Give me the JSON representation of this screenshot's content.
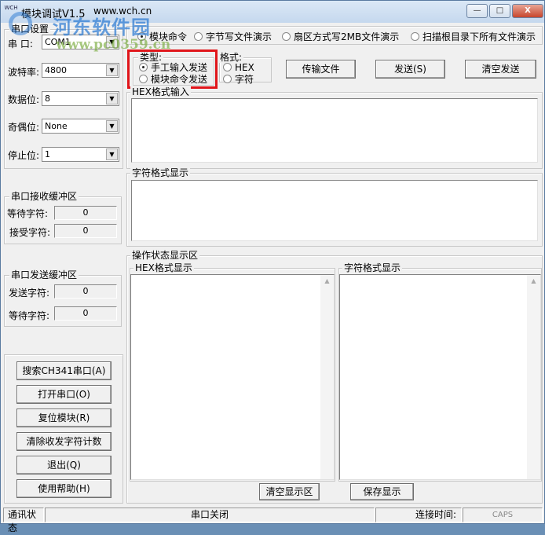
{
  "window": {
    "title": "模块调试V1.5",
    "url": "www.wch.cn",
    "min": "—",
    "max": "□",
    "close": "X",
    "icon_text": "WCH"
  },
  "watermark": {
    "site": "河东软件园",
    "url": "www.pc0359.cn"
  },
  "serial": {
    "group": "串口设置",
    "port_label": "串 口:",
    "port": "COM1",
    "baud_label": "波特率:",
    "baud": "4800",
    "data_label": "数据位:",
    "data": "8",
    "parity_label": "奇偶位:",
    "parity": "None",
    "stop_label": "停止位:",
    "stop": "1"
  },
  "modes": [
    {
      "label": "模块命令",
      "checked": true
    },
    {
      "label": "字节写文件演示",
      "checked": false
    },
    {
      "label": "扇区方式写2MB文件演示",
      "checked": false
    },
    {
      "label": "扫描根目录下所有文件演示",
      "checked": false
    }
  ],
  "type": {
    "group": "类型:",
    "options": [
      {
        "label": "手工输入发送",
        "checked": true
      },
      {
        "label": "模块命令发送",
        "checked": false
      }
    ]
  },
  "format": {
    "group": "格式:",
    "options": [
      {
        "label": "HEX",
        "checked": false
      },
      {
        "label": "字符",
        "checked": false
      }
    ]
  },
  "buttons": {
    "transfer": "传输文件",
    "send": "发送(S)",
    "clear_send": "清空发送",
    "clear_display": "清空显示区",
    "save_display": "保存显示"
  },
  "hex_input": {
    "group": "HEX格式输入",
    "value": ""
  },
  "char_display": {
    "group": "字符格式显示",
    "value": ""
  },
  "rx_buffer": {
    "group": "串口接收缓冲区",
    "wait_label": "等待字符:",
    "wait": "0",
    "recv_label": "接受字符:",
    "recv": "0"
  },
  "tx_buffer": {
    "group": "串口发送缓冲区",
    "send_label": "发送字符:",
    "send": "0",
    "wait_label": "等待字符:",
    "wait": "0"
  },
  "left_buttons": [
    "搜索CH341串口(A)",
    "打开串口(O)",
    "复位模块(R)",
    "清除收发字符计数",
    "退出(Q)",
    "使用帮助(H)"
  ],
  "op_status": {
    "group": "操作状态显示区",
    "hex_group": "HEX格式显示",
    "char_group": "字符格式显示"
  },
  "statusbar": {
    "comm": "通讯状态",
    "port_state": "串口关闭",
    "connect_time": "连接时间:",
    "caps": "CAPS"
  }
}
